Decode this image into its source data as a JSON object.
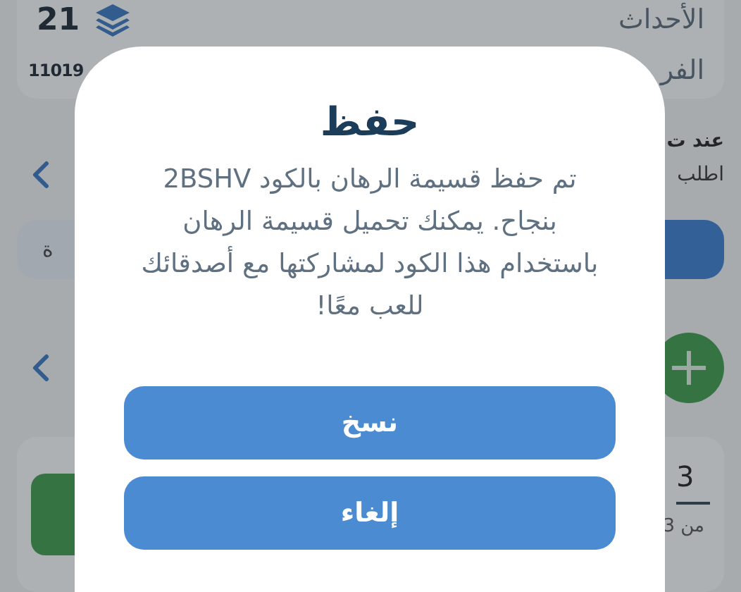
{
  "background": {
    "stats": [
      {
        "label": "الأحداث",
        "value": "21"
      },
      {
        "label": "الفر",
        "value": "11019"
      }
    ],
    "section_title": "عند ت",
    "hint": "اطلب",
    "tab_fragment": "ة",
    "quantity": {
      "value": "3",
      "caption": "من 3"
    }
  },
  "dialog": {
    "title": "حفظ",
    "message": "تم حفظ قسيمة الرهان بالكود 2BSHV بنجاح. يمكنك تحميل قسيمة الرهان باستخدام هذا الكود لمشاركتها مع أصدقائك للعب معًا!",
    "buttons": [
      "نسخ",
      "إلغاء"
    ]
  }
}
